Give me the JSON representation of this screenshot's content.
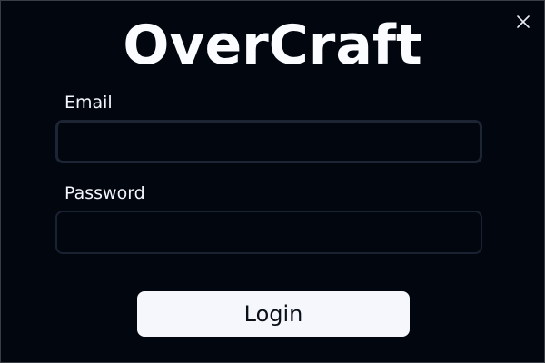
{
  "window": {
    "close_icon": "close-icon"
  },
  "app": {
    "title": "OverCraft"
  },
  "form": {
    "email_label": "Email",
    "email_value": "",
    "email_placeholder": "",
    "password_label": "Password",
    "password_value": "",
    "password_placeholder": "",
    "login_label": "Login"
  },
  "colors": {
    "background": "#02060f",
    "input_border": "#1d2535",
    "button_background": "#f5f7fd",
    "button_text": "#0b0f18",
    "text": "#f4f6fb"
  }
}
